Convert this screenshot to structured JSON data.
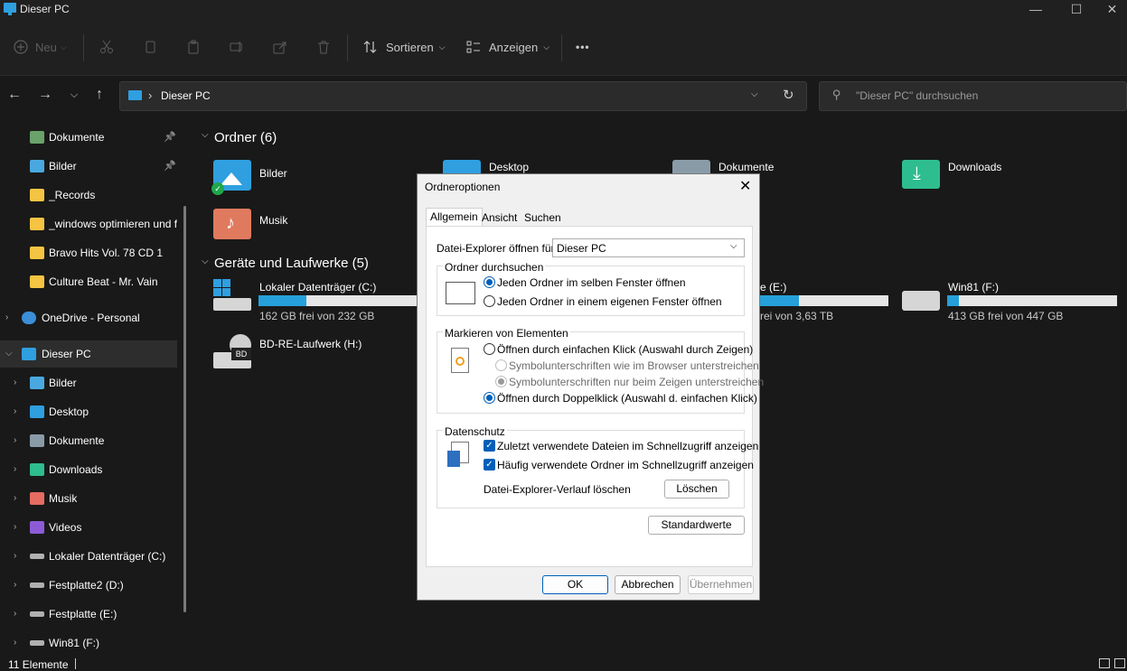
{
  "window": {
    "title": "Dieser PC",
    "min": "—",
    "max": "☐",
    "close": "✕"
  },
  "toolbar": {
    "new_label": "Neu",
    "sort_label": "Sortieren",
    "view_label": "Anzeigen",
    "more_label": "•••"
  },
  "address": {
    "path": "Dieser PC",
    "separator": "›"
  },
  "search": {
    "placeholder": "\"Dieser PC\" durchsuchen"
  },
  "sidebar": {
    "items": [
      {
        "label": "Dokumente",
        "pinned": true,
        "icon": "documents-icon",
        "color": "#6aa36a"
      },
      {
        "label": "Bilder",
        "pinned": true,
        "icon": "pictures-icon",
        "color": "#4aa8e0"
      },
      {
        "label": "_Records",
        "icon": "folder-icon",
        "color": "#f6c443"
      },
      {
        "label": "_windows optimieren und f",
        "icon": "folder-icon",
        "color": "#f6c443"
      },
      {
        "label": "Bravo Hits Vol. 78 CD 1",
        "icon": "folder-icon",
        "color": "#f6c443"
      },
      {
        "label": "Culture Beat - Mr. Vain",
        "icon": "folder-icon",
        "color": "#f6c443"
      },
      {
        "label": "OneDrive - Personal",
        "icon": "onedrive-icon",
        "color": "#3a8fd8"
      },
      {
        "label": "Dieser PC",
        "icon": "this-pc-icon",
        "color": "#2f9fe0",
        "selected": true
      },
      {
        "label": "Bilder",
        "icon": "pictures-icon",
        "color": "#4aa8e0"
      },
      {
        "label": "Desktop",
        "icon": "desktop-icon",
        "color": "#2f9fe0"
      },
      {
        "label": "Dokumente",
        "icon": "documents-icon",
        "color": "#8a9ba8"
      },
      {
        "label": "Downloads",
        "icon": "downloads-icon",
        "color": "#2ebd8e"
      },
      {
        "label": "Musik",
        "icon": "music-icon",
        "color": "#e56c62"
      },
      {
        "label": "Videos",
        "icon": "videos-icon",
        "color": "#8c5cd6"
      },
      {
        "label": "Lokaler Datenträger (C:)",
        "icon": "drive-icon",
        "color": "#b0b0b0"
      },
      {
        "label": "Festplatte2 (D:)",
        "icon": "drive-icon",
        "color": "#b0b0b0"
      },
      {
        "label": "Festplatte (E:)",
        "icon": "drive-icon",
        "color": "#b0b0b0"
      },
      {
        "label": "Win81 (F:)",
        "icon": "drive-icon",
        "color": "#b0b0b0"
      }
    ]
  },
  "content": {
    "folders_header": "Ordner (6)",
    "folders": [
      {
        "label": "Bilder"
      },
      {
        "label": "Desktop"
      },
      {
        "label": "Dokumente"
      },
      {
        "label": "Downloads"
      },
      {
        "label": "Musik"
      }
    ],
    "drives_header": "Geräte und Laufwerke (5)",
    "drives": [
      {
        "label": "Lokaler Datenträger (C:)",
        "sub": "162 GB frei von 232 GB",
        "used_fraction": 0.3
      },
      {
        "label": "e (E:)",
        "sub": "rei von 3,63 TB",
        "used_fraction": 0.3
      },
      {
        "label": "Win81 (F:)",
        "sub": "413 GB frei von 447 GB",
        "used_fraction": 0.07
      },
      {
        "label": "BD-RE-Laufwerk (H:)",
        "sub": ""
      }
    ],
    "bd_badge": "BD"
  },
  "status": {
    "count": "11 Elemente"
  },
  "dialog": {
    "title": "Ordneroptionen",
    "close": "✕",
    "tabs": [
      "Allgemein",
      "Ansicht",
      "Suchen"
    ],
    "open_for_label": "Datei-Explorer öffnen für:",
    "open_for_value": "Dieser PC",
    "browse_group": "Ordner durchsuchen",
    "browse_options": [
      "Jeden Ordner im selben Fenster öffnen",
      "Jeden Ordner in einem eigenen Fenster öffnen"
    ],
    "mark_group": "Markieren von Elementen",
    "mark_options": [
      "Öffnen durch einfachen Klick (Auswahl durch Zeigen)",
      "Symbolunterschriften wie im Browser unterstreichen",
      "Symbolunterschriften nur beim Zeigen unterstreichen",
      "Öffnen durch Doppelklick (Auswahl d. einfachen Klick)"
    ],
    "privacy_group": "Datenschutz",
    "privacy_options": [
      "Zuletzt verwendete Dateien im Schnellzugriff anzeigen",
      "Häufig verwendete Ordner im Schnellzugriff anzeigen"
    ],
    "history_label": "Datei-Explorer-Verlauf löschen",
    "clear_button": "Löschen",
    "defaults_button": "Standardwerte",
    "ok_button": "OK",
    "cancel_button": "Abbrechen",
    "apply_button": "Übernehmen"
  }
}
